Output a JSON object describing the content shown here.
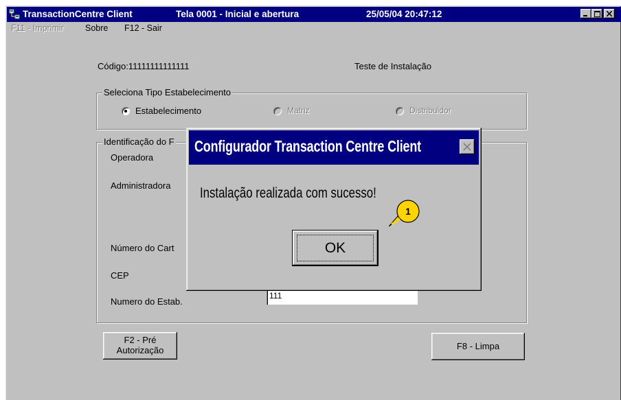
{
  "window": {
    "app_title": "TransactionCentre Client",
    "screen_title": "Tela 0001 - Inicial e abertura",
    "datetime": "25/05/04 20:47:12"
  },
  "menu": {
    "imprimir": "F11 - Imprimir",
    "sobre": "Sobre",
    "sair": "F12 - Sair"
  },
  "form": {
    "codigo": "Código:11111111111111",
    "teste": "Teste de Instalação",
    "tipo_group": "Seleciona Tipo Estabelecimento",
    "radio_estabelecimento": "Estabelecimento",
    "radio_matriz": "Matriz",
    "radio_distribuidor": "Distribuidor",
    "identificacao_group": "Identificação do F",
    "operadora": "Operadora",
    "administradora": "Administradora",
    "numero_cartao": "Número do Cart",
    "cep": "CEP",
    "numero_estab": "Numero do Estab.",
    "numero_estab_value": "111",
    "btn_pre_line1": "F2 - Pré",
    "btn_pre_line2": "Autorização",
    "btn_limpa": "F8 - Limpa"
  },
  "dialog": {
    "title": "Configurador Transaction Centre Client",
    "message": "Instalação realizada com sucesso!",
    "ok_label": "OK"
  },
  "annotation": {
    "marker": "1"
  },
  "colors": {
    "titlebar": "#000080",
    "window_bg": "#c0c0c0",
    "callout_fill": "#ffd400"
  }
}
